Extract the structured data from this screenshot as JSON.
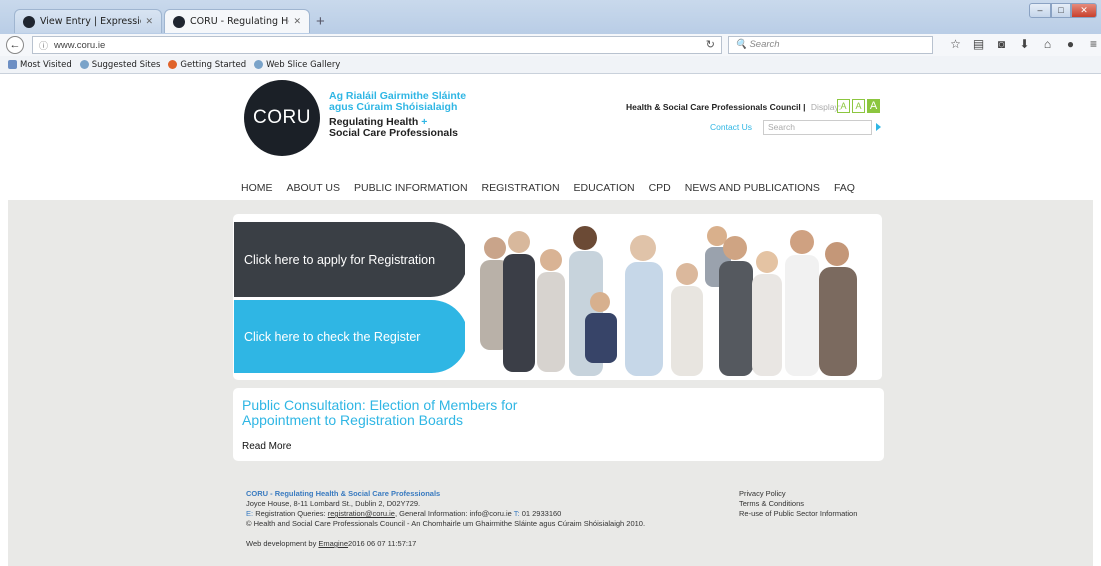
{
  "browser": {
    "tabs": [
      {
        "title": "View Entry | ExpressionEngi...",
        "active": false
      },
      {
        "title": "CORU - Regulating Health ...",
        "active": true
      }
    ],
    "new_tab_label": "+",
    "url": "www.coru.ie",
    "search_placeholder": "Search",
    "bookmarks": [
      "Most Visited",
      "Suggested Sites",
      "Getting Started",
      "Web Slice Gallery"
    ]
  },
  "site": {
    "logo_text": "CORU",
    "tagline_irish_1": "Ag Rialáil Gairmithe Sláinte",
    "tagline_irish_2": "agus Cúraim Shóisialaigh",
    "tagline_english_1": "Regulating Health",
    "tagline_plus": "+",
    "tagline_english_2": "Social Care Professionals",
    "council_name": "Health & Social Care Professionals Council",
    "display_label": "Display:",
    "font_sizes": [
      "A",
      "A",
      "A"
    ],
    "contact_label": "Contact Us",
    "search_placeholder": "Search",
    "nav": [
      "HOME",
      "ABOUT US",
      "PUBLIC INFORMATION",
      "REGISTRATION",
      "EDUCATION",
      "CPD",
      "NEWS AND PUBLICATIONS",
      "FAQ"
    ],
    "cta_apply": "Click here to apply for Registration",
    "cta_check": "Click here to check the Register",
    "news_title": "Public Consultation: Election of Members for Appointment to Registration Boards",
    "read_more": "Read More",
    "footer": {
      "org": "CORU - Regulating Health & Social Care Professionals",
      "address": "Joyce House, 8-11 Lombard St., Dublin 2, D02Y729.",
      "e_label": "E:",
      "registration_queries": "Registration Queries:",
      "registration_email": "registration@coru.ie",
      "general_info": ", General Information: info@coru.ie",
      "t_label": "T:",
      "phone": "01 2933160",
      "copyright": "© Health and Social Care Professionals Council - An Chomhairle um Ghairmithe Sláinte agus Cúraim Shóisialaigh 2010.",
      "web_dev_prefix": "Web development by",
      "web_dev_company": "Emagine",
      "web_dev_date": "2016 06 07 11:57:17",
      "links": [
        "Privacy Policy",
        "Terms & Conditions",
        "Re-use of Public Sector Information"
      ]
    }
  },
  "colors": {
    "accent_blue": "#2fb6e4",
    "accent_green": "#8cc63f",
    "dark_button": "#3a3f45",
    "content_bg": "#e9e9e7"
  }
}
